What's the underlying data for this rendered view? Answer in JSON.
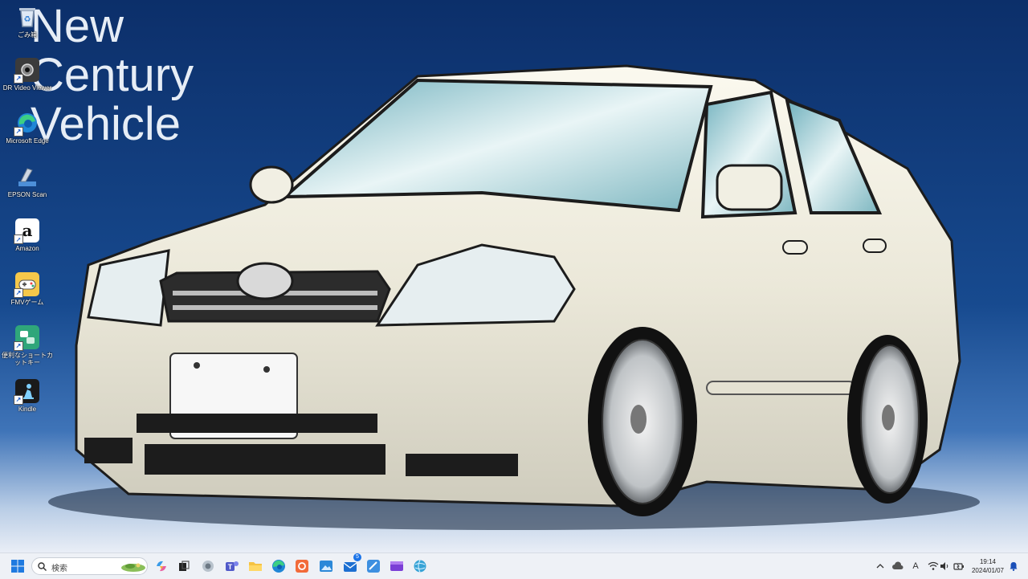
{
  "wallpaper": {
    "title_lines": [
      "New",
      "Century",
      "Vehicle"
    ]
  },
  "desktop_icons": [
    {
      "label": "ごみ箱",
      "icon": "recycle-bin-icon"
    },
    {
      "label": "DR Video Viewer",
      "icon": "dashcam-icon"
    },
    {
      "label": "Microsoft Edge",
      "icon": "edge-icon"
    },
    {
      "label": "EPSON Scan",
      "icon": "scanner-icon"
    },
    {
      "label": "Amazon",
      "icon": "amazon-icon"
    },
    {
      "label": "FMVゲーム",
      "icon": "game-controller-icon"
    },
    {
      "label": "便利なショートカットキー",
      "icon": "shortcut-keys-icon"
    },
    {
      "label": "Kindle",
      "icon": "kindle-icon"
    }
  ],
  "taskbar": {
    "search_placeholder": "検索",
    "mail_badge": "5",
    "ime_indicator": "A",
    "clock_time": "19:14",
    "clock_date": "2024/01/07"
  }
}
